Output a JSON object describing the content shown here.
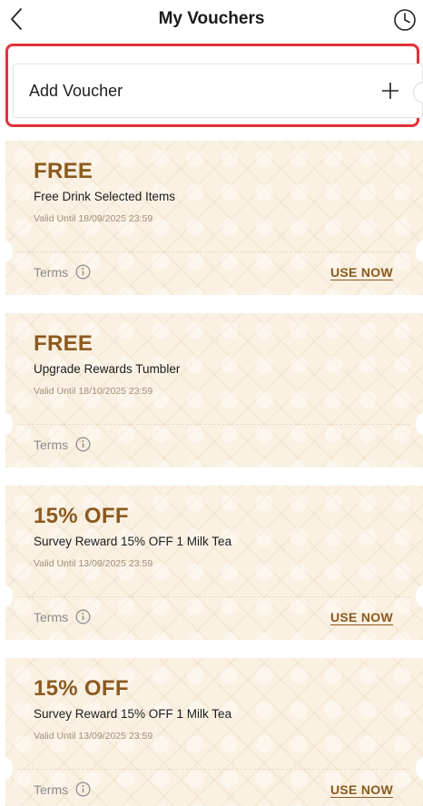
{
  "header": {
    "title": "My Vouchers",
    "back_icon": "chevron-left-icon",
    "history_icon": "clock-icon"
  },
  "add_voucher": {
    "label": "Add Voucher",
    "icon": "plus-icon"
  },
  "colors": {
    "accent": "#8b5a1f",
    "highlight": "#e3323b",
    "voucher_bg": "#faf1e3"
  },
  "vouchers": [
    {
      "headline": "FREE",
      "name": "Free Drink Selected Items",
      "valid": "Valid Until 18/09/2025 23:59",
      "terms_label": "Terms",
      "use_label": "USE NOW"
    },
    {
      "headline": "FREE",
      "name": "Upgrade Rewards Tumbler",
      "valid": "Valid Until 18/10/2025 23:59",
      "terms_label": "Terms"
    },
    {
      "headline": "15% OFF",
      "name": "Survey Reward 15% OFF 1 Milk Tea",
      "valid": "Valid Until 13/09/2025 23:59",
      "terms_label": "Terms",
      "use_label": "USE NOW"
    },
    {
      "headline": "15% OFF",
      "name": "Survey Reward 15% OFF 1 Milk Tea",
      "valid": "Valid Until 13/09/2025 23:59",
      "terms_label": "Terms",
      "use_label": "USE NOW"
    }
  ]
}
